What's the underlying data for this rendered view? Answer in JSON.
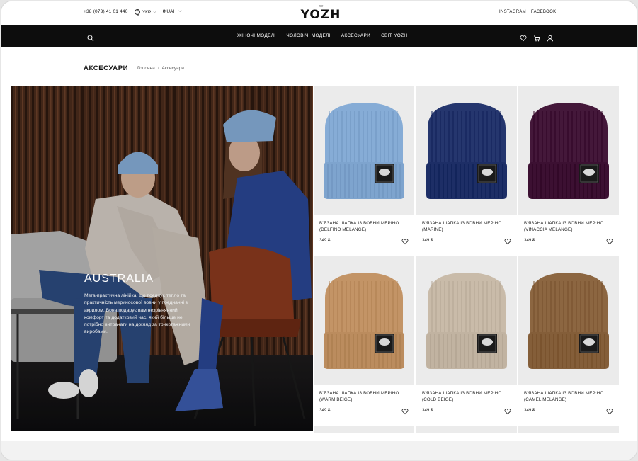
{
  "header": {
    "phone": "+38 (073) 41 01 440",
    "language": "УКР",
    "currency": "₴ UAH",
    "logo_text": "YOZH",
    "social": [
      "INSTAGRAM",
      "FACEBOOK"
    ]
  },
  "nav": {
    "links": [
      "ЖІНОЧІ МОДЕЛІ",
      "ЧОЛОВІЧІ МОДЕЛІ",
      "АКСЕСУАРИ",
      "СВІТ YÖZH"
    ],
    "icons": [
      "search-icon",
      "heart-icon",
      "cart-icon",
      "user-icon"
    ]
  },
  "page": {
    "title": "АКСЕСУАРИ",
    "breadcrumb": [
      "Головна",
      "/",
      "Аксесуари"
    ]
  },
  "hero": {
    "title": "AUSTRALIA",
    "text": "Мега-практична лінійка, що поєднує тепло та практичність мериносової вовни у поєднанні з акрилом. Вона подарує вам незрівнянний комфорт та додатковий час, який більше не потрібно витрачати на догляд за трикотажними виробами."
  },
  "products": [
    {
      "name": "В'ЯЗАНА ШАПКА ІЗ ВОВНИ МЕРІНО (DELFINO MELANGE)",
      "price": "349 ₴",
      "color": "#86acd6"
    },
    {
      "name": "В'ЯЗАНА ШАПКА ІЗ ВОВНИ МЕРІНО (MARINE)",
      "price": "349 ₴",
      "color": "#25366e"
    },
    {
      "name": "В'ЯЗАНА ШАПКА ІЗ ВОВНИ МЕРІНО (VINACCIA MELANGE)",
      "price": "349 ₴",
      "color": "#44183a"
    },
    {
      "name": "В'ЯЗАНА ШАПКА ІЗ ВОВНИ МЕРІНО (WARM BEIGE)",
      "price": "349 ₴",
      "color": "#c39466"
    },
    {
      "name": "В'ЯЗАНА ШАПКА ІЗ ВОВНИ МЕРІНО (COLD BEIGE)",
      "price": "349 ₴",
      "color": "#c9bba9"
    },
    {
      "name": "В'ЯЗАНА ШАПКА ІЗ ВОВНИ МЕРІНО (CAMEL MELANGE)",
      "price": "349 ₴",
      "color": "#8c6641"
    }
  ]
}
